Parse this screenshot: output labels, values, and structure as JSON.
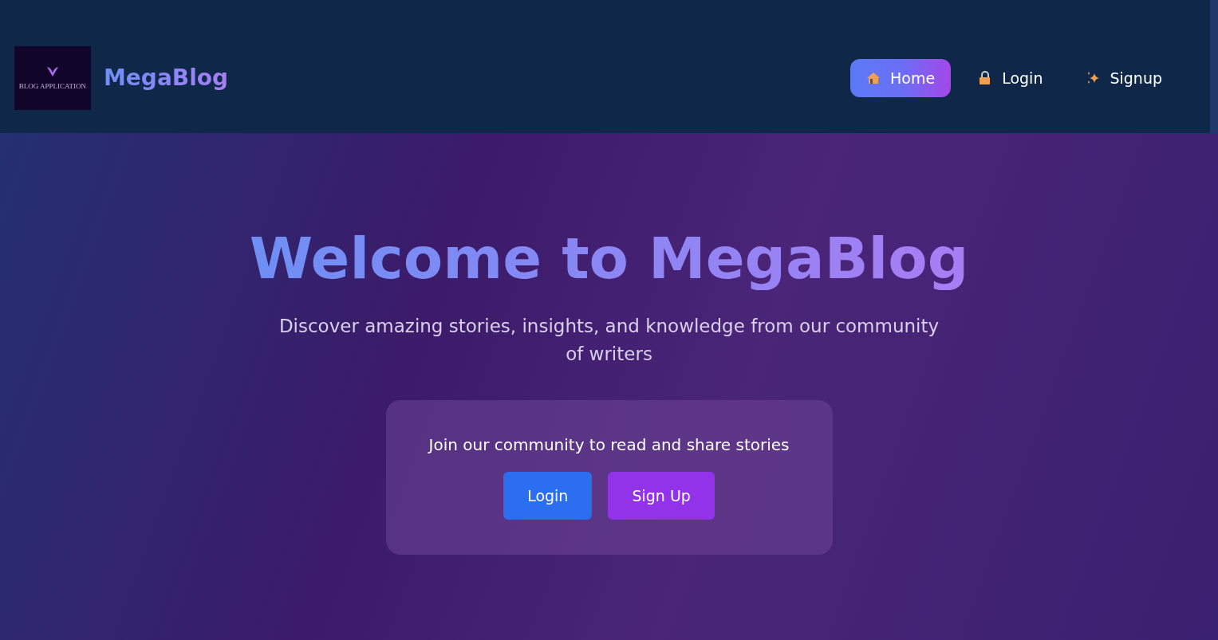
{
  "header": {
    "logo": {
      "caption": "BLOG APPLICATION"
    },
    "brand": "MegaBlog",
    "nav": [
      {
        "label": "Home",
        "kind": "house",
        "selected": true
      },
      {
        "label": "Login",
        "kind": "lock",
        "selected": false
      },
      {
        "label": "Signup",
        "kind": "sparkle",
        "selected": false
      }
    ]
  },
  "hero": {
    "title": "Welcome to MegaBlog",
    "subtitle": "Discover amazing stories, insights, and knowledge from our community of writers",
    "card": {
      "text": "Join our community to read and share stories",
      "buttons": [
        {
          "label": "Login",
          "kind": "primary"
        },
        {
          "label": "Sign Up",
          "kind": "secondary"
        }
      ]
    }
  }
}
